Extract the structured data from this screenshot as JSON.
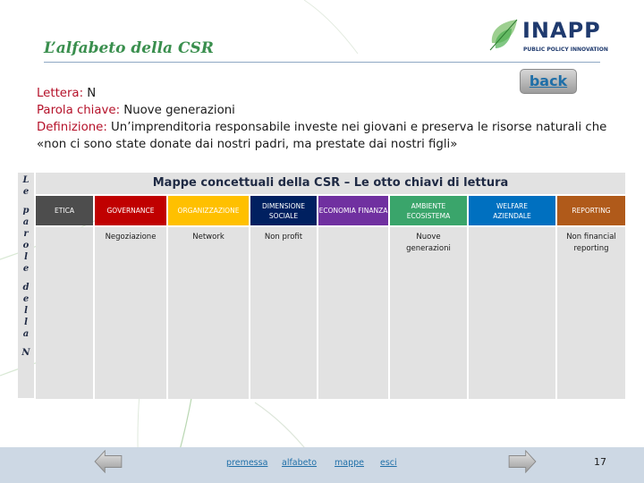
{
  "header": {
    "title": "L’alfabeto della CSR",
    "logo": {
      "name": "INAPP",
      "tagline": "PUBLIC POLICY INNOVATION",
      "icon": "leaf-icon"
    },
    "back_label": "back"
  },
  "info": {
    "letter_label": "Lettera:",
    "letter_value": " N",
    "keyword_label": "Parola chiave:",
    "keyword_value": " Nuove generazioni",
    "definition_label": "Definizione:",
    "definition_value": " Un’imprenditoria responsabile investe nei giovani e preserva le risorse naturali che «non ci sono state donate dai nostri padri, ma prestate dai nostri figli»"
  },
  "side_label": [
    "L",
    "e",
    "",
    "p",
    "a",
    "r",
    "o",
    "l",
    "e",
    "",
    "d",
    "e",
    "l",
    "l",
    "a",
    "",
    "N"
  ],
  "map": {
    "title": "Mappe concettuali della CSR – Le otto chiavi di lettura",
    "columns": [
      {
        "label": "ETICA",
        "color": "#4d4d4d",
        "entry": ""
      },
      {
        "label": "GOVERNANCE",
        "color": "#c00000",
        "entry": "Negoziazione"
      },
      {
        "label": "ORGANIZZAZIONE",
        "color": "#ffc000",
        "entry": "Network"
      },
      {
        "label": "DIMENSIONE SOCIALE",
        "color": "#002060",
        "entry": "Non profit"
      },
      {
        "label": "ECONOMIA FINANZA",
        "color": "#7030a0",
        "entry": ""
      },
      {
        "label": "AMBIENTE ECOSISTEMA",
        "color": "#3aa56b",
        "entry": "Nuove generazioni"
      },
      {
        "label": "WELFARE AZIENDALE",
        "color": "#0070c0",
        "entry": ""
      },
      {
        "label": "REPORTING",
        "color": "#b05a1a",
        "entry": "Non financial reporting"
      }
    ]
  },
  "footer": {
    "prev_icon": "arrow-left-icon",
    "next_icon": "arrow-right-icon",
    "links": [
      "premessa",
      "alfabeto",
      "mappe",
      "esci"
    ],
    "page_number": "17"
  }
}
